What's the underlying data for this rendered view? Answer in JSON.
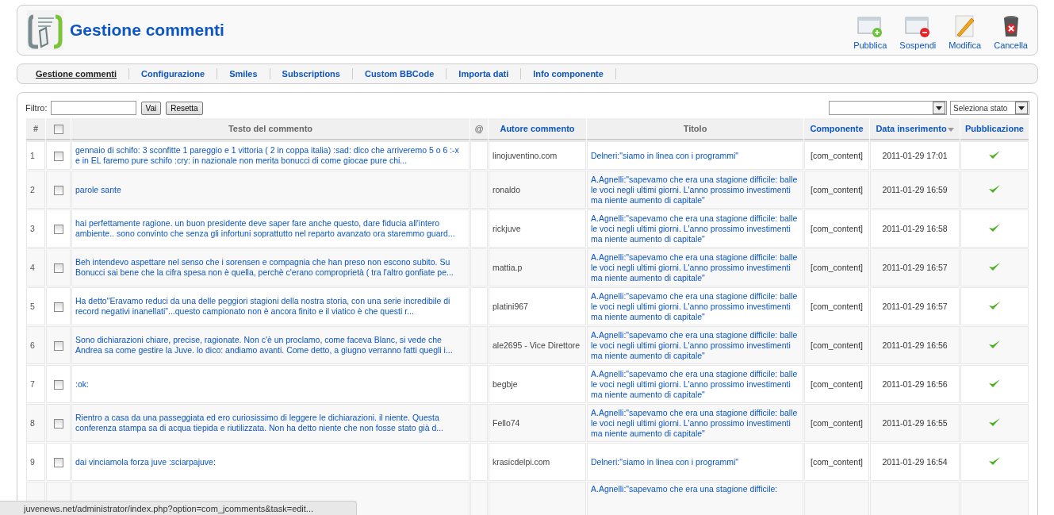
{
  "header": {
    "title": "Gestione commenti"
  },
  "toolbar": [
    {
      "kind": "publish",
      "label": "Pubblica"
    },
    {
      "kind": "unpublish",
      "label": "Sospendi"
    },
    {
      "kind": "edit",
      "label": "Modifica"
    },
    {
      "kind": "delete",
      "label": "Cancella"
    }
  ],
  "tabs": [
    {
      "label": "Gestione commenti",
      "selected": true
    },
    {
      "label": "Configurazione",
      "selected": false
    },
    {
      "label": "Smiles",
      "selected": false
    },
    {
      "label": "Subscriptions",
      "selected": false
    },
    {
      "label": "Custom BBCode",
      "selected": false
    },
    {
      "label": "Importa dati",
      "selected": false
    },
    {
      "label": "Info componente",
      "selected": false
    }
  ],
  "filter": {
    "label": "Filtro:",
    "buttons": [
      "Vai",
      "Resetta"
    ],
    "state_select": "Seleziona stato"
  },
  "table": {
    "select_all_checked": false,
    "columns": [
      {
        "label": "#",
        "link": false
      },
      {
        "kind": "checkbox"
      },
      {
        "label": "Testo del commento",
        "link": false
      },
      {
        "label": "@",
        "link": false
      },
      {
        "label": "Autore commento",
        "link": true
      },
      {
        "label": "Titolo",
        "link": false
      },
      {
        "label": "Componente",
        "link": true
      },
      {
        "label": "Data inserimento",
        "link": true,
        "sorted": true
      },
      {
        "label": "Pubblicazione",
        "link": true
      }
    ],
    "rows": [
      {
        "number": "1",
        "checked": false,
        "comment": "gennaio di schifo: 3 sconfitte 1 pareggio e 1 vittoria ( 2 in coppa italia) :sad: dico che arriveremo 5 o 6 :-x e in EL faremo pure schifo :cry: in nazionale non merita bonucci di come giocae pure chi...",
        "author": "linojuventino.com",
        "title": "Delneri:\"siamo in linea con i programmi\"",
        "component": "[com_content]",
        "date": "2011-01-29 17:01",
        "published": true
      },
      {
        "number": "2",
        "checked": false,
        "comment": "parole sante",
        "author": "ronaldo",
        "title": "A.Agnelli:\"sapevamo che era una stagione difficile: balle le voci negli ultimi giorni. L'anno prossimo investimenti ma niente aumento di capitale\"",
        "component": "[com_content]",
        "date": "2011-01-29 16:59",
        "published": true
      },
      {
        "number": "3",
        "checked": false,
        "comment": "hai perfettamente ragione. un buon presidente deve saper fare anche questo, dare fiducia all'intero ambiente.. sono convinto che senza gli infortuni soprattutto nel reparto avanzato ora staremmo guard...",
        "author": "rickjuve",
        "title": "A.Agnelli:\"sapevamo che era una stagione difficile: balle le voci negli ultimi giorni. L'anno prossimo investimenti ma niente aumento di capitale\"",
        "component": "[com_content]",
        "date": "2011-01-29 16:58",
        "published": true
      },
      {
        "number": "4",
        "checked": false,
        "comment": "Beh intendevo aspettare nel senso che i sorensen e compagnia che han preso non escono subito. Su Bonucci sai bene che la cifra spesa non è quella, perchè c'erano comproprietà ( tra l'altro gonfiate pe...",
        "author": "mattia.p",
        "title": "A.Agnelli:\"sapevamo che era una stagione difficile: balle le voci negli ultimi giorni. L'anno prossimo investimenti ma niente aumento di capitale\"",
        "component": "[com_content]",
        "date": "2011-01-29 16:57",
        "published": true
      },
      {
        "number": "5",
        "checked": false,
        "comment": "Ha detto\"Eravamo reduci da una delle peggiori stagioni della nostra storia, con una serie incredibile di record negativi inanellati\"...questo campionato non è ancora finito e il viatico è che questi r...",
        "author": "platini967",
        "title": "A.Agnelli:\"sapevamo che era una stagione difficile: balle le voci negli ultimi giorni. L'anno prossimo investimenti ma niente aumento di capitale\"",
        "component": "[com_content]",
        "date": "2011-01-29 16:57",
        "published": true
      },
      {
        "number": "6",
        "checked": false,
        "comment": "Sono dichiarazioni chiare, precise, ragionate. Non c'è un proclamo, come faceva Blanc, si vede che Andrea sa come gestire la Juve. lo dico: andiamo avanti. Come detto, a giugno verranno fatti quegli i...",
        "author": "ale2695 - Vice Direttore",
        "title": "A.Agnelli:\"sapevamo che era una stagione difficile: balle le voci negli ultimi giorni. L'anno prossimo investimenti ma niente aumento di capitale\"",
        "component": "[com_content]",
        "date": "2011-01-29 16:56",
        "published": true
      },
      {
        "number": "7",
        "checked": false,
        "comment": ":ok:",
        "author": "begbje",
        "title": "A.Agnelli:\"sapevamo che era una stagione difficile: balle le voci negli ultimi giorni. L'anno prossimo investimenti ma niente aumento di capitale\"",
        "component": "[com_content]",
        "date": "2011-01-29 16:56",
        "published": true
      },
      {
        "number": "8",
        "checked": false,
        "comment": "Rientro a casa da una passeggiata ed ero curiosissimo di leggere le dichiarazioni. il niente. Questa conferenza stampa sa di acqua tiepida e riutilizzata. Non ha detto niente che non fosse stato già d...",
        "author": "Fello74",
        "title": "A.Agnelli:\"sapevamo che era una stagione difficile: balle le voci negli ultimi giorni. L'anno prossimo investimenti ma niente aumento di capitale\"",
        "component": "[com_content]",
        "date": "2011-01-29 16:55",
        "published": true
      },
      {
        "number": "9",
        "checked": false,
        "comment": "dai vinciamola forza juve :sciarpajuve:",
        "author": "krasicdelpi.com",
        "title": "Delneri:\"siamo in linea con i programmi\"",
        "component": "[com_content]",
        "date": "2011-01-29 16:54",
        "published": true
      },
      {
        "title": "A.Agnelli:\"sapevamo che era una stagione difficile:"
      }
    ]
  },
  "status_bar": "juvenews.net/administrator/index.php?option=com_jcomments&task=edit..."
}
